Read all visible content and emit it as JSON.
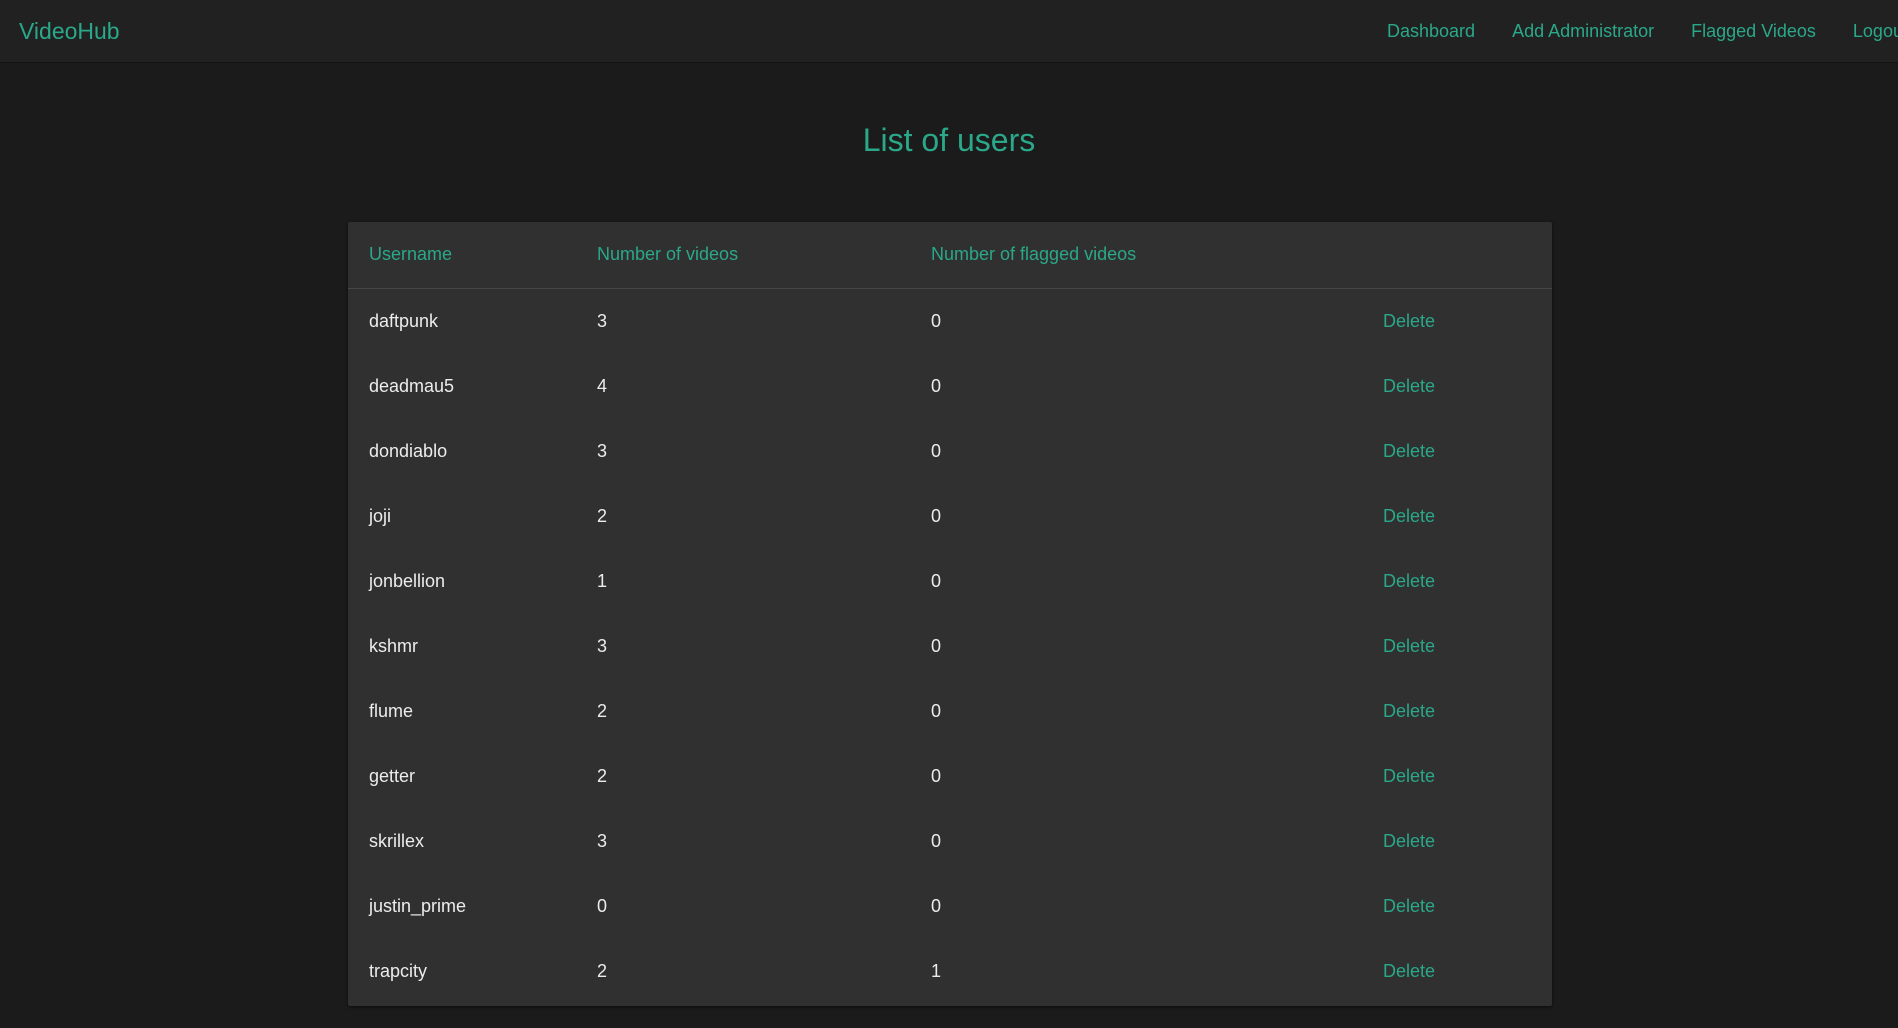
{
  "navbar": {
    "brand": "VideoHub",
    "links": [
      "Dashboard",
      "Add Administrator",
      "Flagged Videos",
      "Logout"
    ]
  },
  "page": {
    "title": "List of users"
  },
  "table": {
    "headers": [
      "Username",
      "Number of videos",
      "Number of flagged videos",
      ""
    ],
    "action_label": "Delete",
    "rows": [
      {
        "username": "daftpunk",
        "videos": "3",
        "flagged": "0"
      },
      {
        "username": "deadmau5",
        "videos": "4",
        "flagged": "0"
      },
      {
        "username": "dondiablo",
        "videos": "3",
        "flagged": "0"
      },
      {
        "username": "joji",
        "videos": "2",
        "flagged": "0"
      },
      {
        "username": "jonbellion",
        "videos": "1",
        "flagged": "0"
      },
      {
        "username": "kshmr",
        "videos": "3",
        "flagged": "0"
      },
      {
        "username": "flume",
        "videos": "2",
        "flagged": "0"
      },
      {
        "username": "getter",
        "videos": "2",
        "flagged": "0"
      },
      {
        "username": "skrillex",
        "videos": "3",
        "flagged": "0"
      },
      {
        "username": "justin_prime",
        "videos": "0",
        "flagged": "0"
      },
      {
        "username": "trapcity",
        "videos": "2",
        "flagged": "1"
      }
    ]
  },
  "colors": {
    "accent": "#2aa889",
    "background": "#1b1b1b",
    "navbar": "#212121",
    "card": "#303030",
    "text": "#ececec"
  }
}
